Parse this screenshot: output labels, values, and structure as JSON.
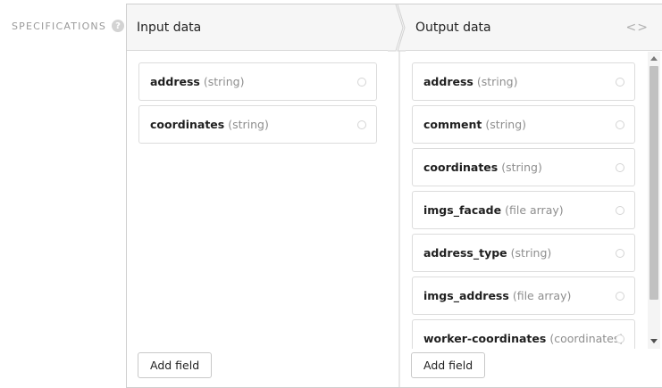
{
  "specifications": {
    "label": "SPECIFICATIONS",
    "help_glyph": "?"
  },
  "input": {
    "title": "Input data",
    "fields": [
      {
        "name": "address",
        "type": "(string)"
      },
      {
        "name": "coordinates",
        "type": "(string)"
      }
    ],
    "add_label": "Add field"
  },
  "output": {
    "title": "Output data",
    "code_toggle_glyph": "<>",
    "fields": [
      {
        "name": "address",
        "type": "(string)"
      },
      {
        "name": "comment",
        "type": "(string)"
      },
      {
        "name": "coordinates",
        "type": "(string)"
      },
      {
        "name": "imgs_facade",
        "type": "(file array)"
      },
      {
        "name": "address_type",
        "type": "(string)"
      },
      {
        "name": "imgs_address",
        "type": "(file array)"
      },
      {
        "name": "worker-coordinates",
        "type": "(coordinates)"
      }
    ],
    "add_label": "Add field"
  },
  "icons": {
    "help": "help-icon",
    "code_toggle": "code-icon",
    "field_marker": "radio-circle-icon",
    "scroll_up": "arrow-up-icon",
    "scroll_down": "arrow-down-icon"
  },
  "colors": {
    "header_bg": "#f6f6f6",
    "border": "#cfcfcf",
    "muted_text": "#8e8e8e",
    "scroll_thumb": "#c1c1c1"
  }
}
